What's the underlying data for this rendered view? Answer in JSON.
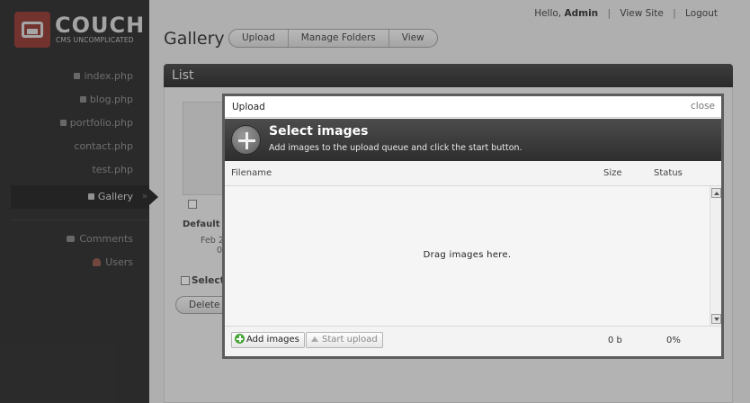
{
  "logo": {
    "name": "COUCH",
    "tagline": "CMS UNCOMPLICATED"
  },
  "sidebar": {
    "items": [
      {
        "label": "index.php"
      },
      {
        "label": "blog.php"
      },
      {
        "label": "portfolio.php"
      },
      {
        "label": "contact.php"
      },
      {
        "label": "test.php"
      },
      {
        "label": "Gallery",
        "active": true
      }
    ],
    "extra": [
      {
        "label": "Comments"
      },
      {
        "label": "Users"
      }
    ]
  },
  "topbar": {
    "greeting": "Hello,",
    "user": "Admin",
    "view_site": "View Site",
    "logout": "Logout"
  },
  "page": {
    "title": "Gallery",
    "buttons": [
      "Upload",
      "Manage Folders",
      "View"
    ],
    "list_title": "List",
    "item_title": "Default pa",
    "item_date": "Feb 2",
    "item_extra": "0",
    "select_all": "Select",
    "delete_btn": "Delete S"
  },
  "modal": {
    "title": "Upload",
    "close": "close",
    "heading": "Select images",
    "subheading": "Add images to the upload queue and click the start button.",
    "columns": {
      "filename": "Filename",
      "size": "Size",
      "status": "Status"
    },
    "drop_text": "Drag images here.",
    "add_button": "Add images",
    "start_button": "Start upload",
    "total_size": "0 b",
    "total_status": "0%"
  }
}
